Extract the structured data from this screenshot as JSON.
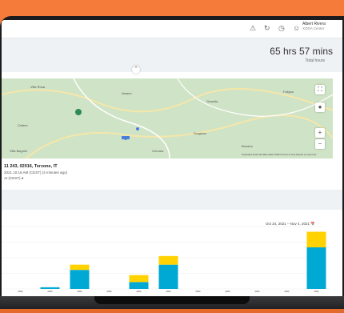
{
  "header": {
    "user_name": "Albert Rivera",
    "user_org": "XODA Center",
    "icons": [
      "notification-icon",
      "refresh-icon",
      "clock-icon",
      "user-icon"
    ]
  },
  "summary": {
    "total_hours": "65 hrs 57 mins",
    "total_label": "Total hours"
  },
  "map": {
    "labels": [
      "Villa Rosa",
      "Varano",
      "Guardia",
      "Foligno",
      "Cellere",
      "Sorgiano",
      "Bonano",
      "Cervara",
      "Villa Bagnini"
    ],
    "attribution": "Keyboard shortcuts   Map data ©2021   Terms of Use   Report a map error"
  },
  "location": {
    "address": "11 243, 02016, Terzone, IT",
    "time": "2021 10:16 AM (CEST) (4 minutes ago)",
    "link": "At (CEST) ●"
  },
  "chart_data": {
    "type": "bar",
    "date_range": "Oct 24, 2021 – Nov 4, 2021",
    "categories": [
      "",
      "",
      "",
      "",
      "",
      "",
      "",
      "",
      "",
      "",
      ""
    ],
    "series": [
      {
        "color": "#00a9d4",
        "values": [
          0,
          1,
          11,
          0,
          4,
          14,
          0,
          0,
          0,
          0,
          24
        ]
      },
      {
        "color": "#ffd200",
        "values": [
          0,
          0,
          3,
          0,
          4,
          5,
          0,
          0,
          0,
          0,
          9
        ]
      }
    ],
    "ylim": [
      0,
      36
    ]
  }
}
